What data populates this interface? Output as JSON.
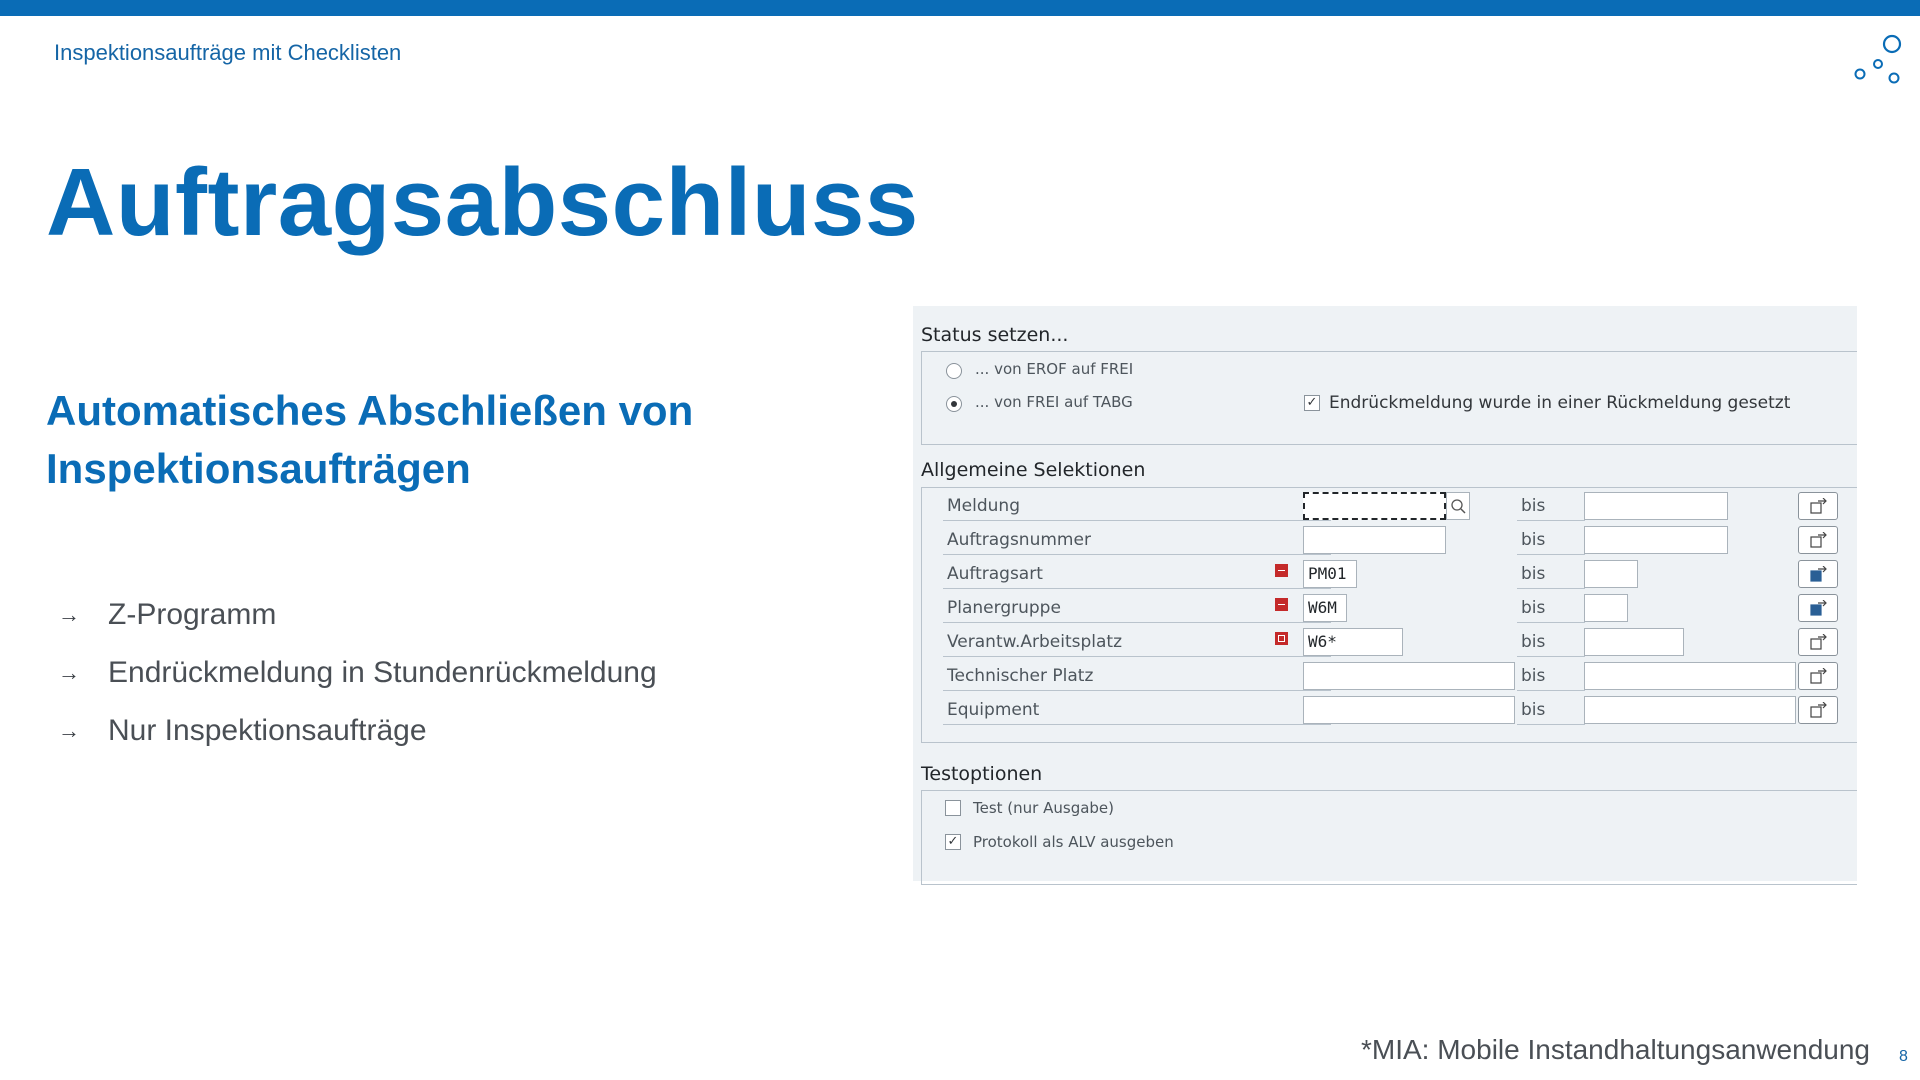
{
  "header": {
    "breadcrumb": "Inspektionsaufträge mit Checklisten"
  },
  "title": "Auftragsabschluss",
  "subtitle": "Automatisches Abschließen von Inspektionsaufträgen",
  "bullets": [
    "Z-Programm",
    "Endrückmeldung in Stundenrückmeldung",
    "Nur Inspektionsaufträge"
  ],
  "footer_note": "*MIA: Mobile Instandhaltungsanwendung",
  "page_number": "8",
  "sap": {
    "status": {
      "title": "Status setzen...",
      "radio1": "... von EROF auf FREI",
      "radio2": "... von FREI auf TABG",
      "radio_selected": 2,
      "checkbox_label": "Endrückmeldung wurde in einer Rückmeldung gesetzt",
      "checkbox_checked": true
    },
    "selections": {
      "title": "Allgemeine Selektionen",
      "bis": "bis",
      "rows": [
        {
          "label": "Meldung",
          "value": "",
          "required": false
        },
        {
          "label": "Auftragsnummer",
          "value": "",
          "required": false
        },
        {
          "label": "Auftragsart",
          "value": "PM01",
          "required": true
        },
        {
          "label": "Planergruppe",
          "value": "W6M",
          "required": true
        },
        {
          "label": "Verantw.Arbeitsplatz",
          "value": "W6*",
          "required": true
        },
        {
          "label": "Technischer Platz",
          "value": "",
          "required": false
        },
        {
          "label": "Equipment",
          "value": "",
          "required": false
        }
      ]
    },
    "test": {
      "title": "Testoptionen",
      "opt1": "Test (nur Ausgabe)",
      "opt1_checked": false,
      "opt2": "Protokoll als ALV ausgeben",
      "opt2_checked": true
    }
  },
  "colors": {
    "brand": "#0a6cb6",
    "required": "#c42a2a"
  }
}
